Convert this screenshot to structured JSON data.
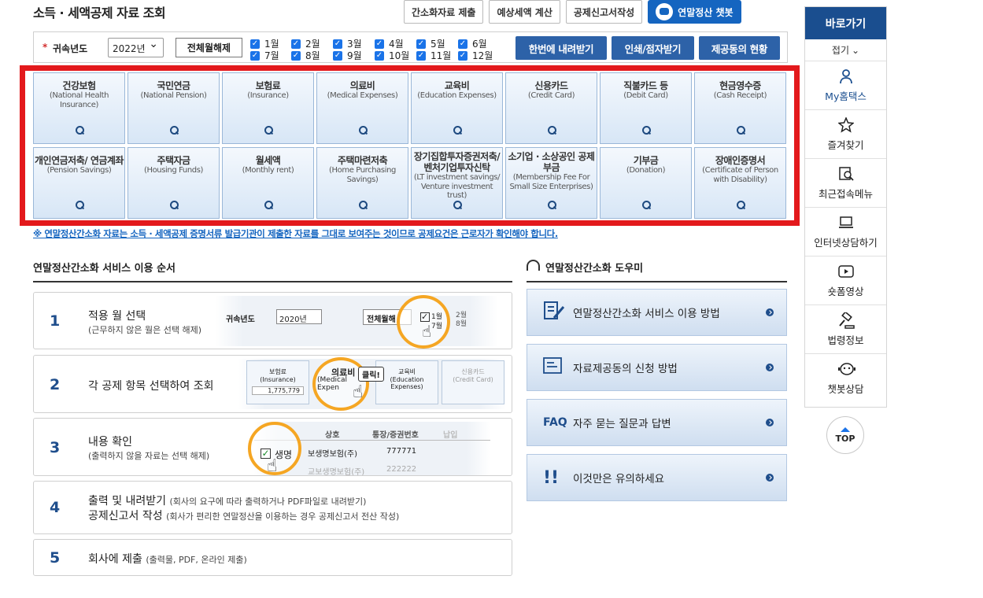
{
  "page_title": "소득 · 세액공제 자료 조회",
  "top_buttons": [
    "간소화자료 제출",
    "예상세액 계산",
    "공제신고서작성",
    "연말정산 챗봇"
  ],
  "filter": {
    "required_mark": "*",
    "year_label": "귀속년도",
    "year_value": "2022년",
    "clear_months": "전체월해제",
    "months": [
      "1월",
      "2월",
      "3월",
      "4월",
      "5월",
      "6월",
      "7월",
      "8월",
      "9월",
      "10월",
      "11월",
      "12월"
    ],
    "download_all": "한번에 내려받기",
    "print": "인쇄/점자받기",
    "providers": "제공동의 현황"
  },
  "categories": [
    {
      "ko": "건강보험",
      "en": "(National Health Insurance)"
    },
    {
      "ko": "국민연금",
      "en": "(National Pension)"
    },
    {
      "ko": "보험료",
      "en": "(Insurance)"
    },
    {
      "ko": "의료비",
      "en": "(Medical Expenses)"
    },
    {
      "ko": "교육비",
      "en": "(Education Expenses)"
    },
    {
      "ko": "신용카드",
      "en": "(Credit Card)"
    },
    {
      "ko": "직불카드 등",
      "en": "(Debit Card)"
    },
    {
      "ko": "현금영수증",
      "en": "(Cash Receipt)"
    },
    {
      "ko": "개인연금저축/ 연금계좌",
      "en": "(Pension Savings)"
    },
    {
      "ko": "주택자금",
      "en": "(Housing Funds)"
    },
    {
      "ko": "월세액",
      "en": "(Monthly rent)"
    },
    {
      "ko": "주택마련저축",
      "en": "(Home Purchasing Savings)"
    },
    {
      "ko": "장기집합투자증권저축/ 벤처기업투자신탁",
      "en": "(LT investment savings/ Venture investment trust)"
    },
    {
      "ko": "소기업 · 소상공인 공제부금",
      "en": "(Membership Fee For Small Size Enterprises)"
    },
    {
      "ko": "기부금",
      "en": "(Donation)"
    },
    {
      "ko": "장애인증명서",
      "en": "(Certificate of Person with Disability)"
    }
  ],
  "notice": "※ 연말정산간소화 자료는 소득 · 세액공제 증명서류 발급기관이 제출한 자료를 그대로 보여주는 것이므로 공제요건은 근로자가 확인해야 합니다.",
  "steps_title": "연말정산간소화 서비스 이용 순서",
  "steps": [
    {
      "num": "1",
      "title": "적용 월 선택",
      "sub": "(근무하지 않은 월은 선택 해제)"
    },
    {
      "num": "2",
      "title": "각 공제 항목 선택하여 조회",
      "sub": ""
    },
    {
      "num": "3",
      "title": "내용 확인",
      "sub": "(출력하지 않을 자료는 선택 해제)"
    },
    {
      "num": "4",
      "title": "출력 및 내려받기",
      "sub": "(회사의 요구에 따라 출력하거나 PDF파일로 내려받기)",
      "title2": "공제신고서 작성",
      "sub2": "(회사가 편리한 연말정산을 이용하는 경우 공제신고서 전산 작성)"
    },
    {
      "num": "5",
      "title": "회사에 제출",
      "sub": "(출력물, PDF, 온라인 제출)"
    }
  ],
  "step_illustrations": {
    "s1_year_label": "귀속년도",
    "s1_year": "2020년",
    "s1_clear": "전체월해",
    "s1_months": [
      "1월",
      "2월",
      "7월",
      "8월"
    ],
    "s2_cells": [
      {
        "ko": "보험료",
        "en": "(Insurance)",
        "amount": "1,775,779"
      },
      {
        "ko": "의료비",
        "en": "(Medical Expen"
      },
      {
        "ko": "교육비",
        "en": "(Education Expenses)"
      },
      {
        "ko": "신용카드",
        "en": "(Credit Card)"
      }
    ],
    "s2_click": "클릭!",
    "s3_headers": [
      "상호",
      "통장/증권번호",
      "납입"
    ],
    "s3_row1": [
      "생명",
      "보생명보험(주)",
      "777771"
    ],
    "s3_row2": [
      "",
      "교보생명보험(주)",
      "222222"
    ]
  },
  "helper_title": "연말정산간소화 도우미",
  "helpers": [
    {
      "icon": "doc-pen-icon",
      "label": "연말정산간소화 서비스 이용 방법"
    },
    {
      "icon": "doc-icon",
      "label": "자료제공동의 신청 방법"
    },
    {
      "icon": "faq-icon",
      "prefix": "FAQ",
      "label": "자주 묻는 질문과 답변"
    },
    {
      "icon": "warning-icon",
      "label": "이것만은 유의하세요"
    }
  ],
  "sidebar": {
    "title": "바로가기",
    "fold": "접기",
    "items": [
      {
        "label": "My홈택스",
        "icon": "person-icon",
        "active": true
      },
      {
        "label": "즐겨찾기",
        "icon": "star-icon"
      },
      {
        "label": "최근접속메뉴",
        "icon": "recent-menu-icon"
      },
      {
        "label": "인터넷상담하기",
        "icon": "laptop-icon"
      },
      {
        "label": "숏폼영상",
        "icon": "play-icon"
      },
      {
        "label": "법령정보",
        "icon": "gavel-icon"
      },
      {
        "label": "챗봇상담",
        "icon": "chatbot-icon"
      }
    ],
    "top": "TOP"
  },
  "colors": {
    "accent": "#1565c0",
    "navy": "#1f4e8c",
    "highlight": "#e3191c",
    "orange": "#f5a623"
  }
}
